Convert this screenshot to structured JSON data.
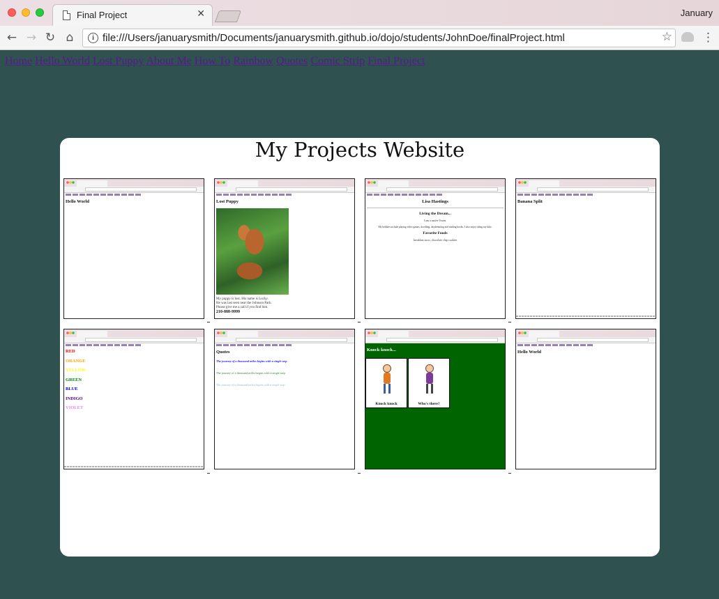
{
  "browser": {
    "tab_title": "Final Project",
    "tab_close": "✕",
    "profile_name": "January",
    "url": "file:///Users/januarysmith/Documents/januarysmith.github.io/dojo/students/JohnDoe/finalProject.html",
    "icons": [
      "back-icon",
      "forward-icon",
      "reload-icon",
      "home-icon",
      "info-icon",
      "star-icon",
      "extension-icon",
      "menu-icon"
    ]
  },
  "nav": {
    "links": [
      "Home",
      "Hello World",
      "Lost Puppy",
      "About Me",
      "How To",
      "Rainbow",
      "Quotes",
      "Comic Strip",
      "Final Project"
    ]
  },
  "page": {
    "title": "My Projects Website"
  },
  "thumbnails": {
    "hello_world": {
      "heading": "Hello World"
    },
    "lost_puppy": {
      "heading": "Lost Puppy",
      "lines": [
        "My puppy is lost. His name is Lucky.",
        "He was last seen near the Johnson Park.",
        "Please give me a call if you find him."
      ],
      "phone": "210-888-9999"
    },
    "about_me": {
      "heading": "Lisa Hastings",
      "subheading": "Living the Dream...",
      "line1": "I am a native Texan.",
      "line2": "My hobbies include playing video games, doodling, daydreaming and reading books. I also enjoy riding my bike.",
      "foods_heading": "Favorite Foods",
      "foods": "breakfast tacos, chocolate chip cookies"
    },
    "how_to": {
      "heading": "Banana Split"
    },
    "rainbow": {
      "colors": [
        {
          "name": "RED",
          "color": "#ff0000"
        },
        {
          "name": "ORANGE",
          "color": "#ffa500"
        },
        {
          "name": "YELLOW",
          "color": "#ffff00"
        },
        {
          "name": "GREEN",
          "color": "#008000"
        },
        {
          "name": "BLUE",
          "color": "#0000ff"
        },
        {
          "name": "INDIGO",
          "color": "#4b0082"
        },
        {
          "name": "VIOLET",
          "color": "#ee82ee"
        }
      ]
    },
    "quotes": {
      "heading": "Quotes",
      "quote": "The journey of a thousand miles begins with a single step"
    },
    "comic": {
      "heading": "Knock knock...",
      "panel1": "Knock knock",
      "panel2": "Who's there?",
      "background": "#006400"
    },
    "final": {
      "heading": "Hello World"
    }
  }
}
